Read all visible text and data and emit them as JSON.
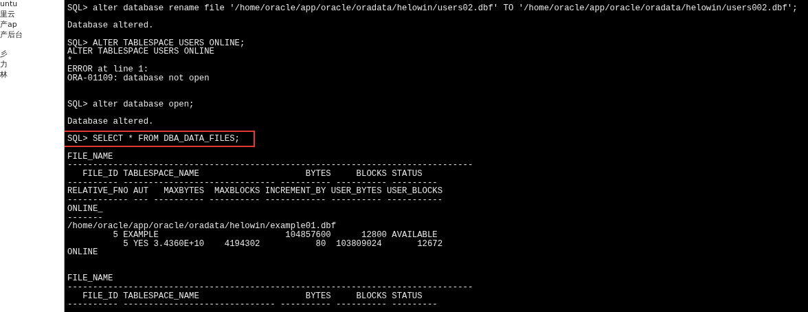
{
  "sidebar": {
    "items": [
      {
        "label": "untu"
      },
      {
        "label": "里云"
      },
      {
        "label": "产ap"
      },
      {
        "label": "产后台"
      },
      {
        "kind": "gap"
      },
      {
        "label": "彡"
      },
      {
        "label": "力"
      },
      {
        "label": "林"
      }
    ]
  },
  "terminal": {
    "lines": [
      {
        "kind": "text",
        "text": "SQL> alter database rename file '/home/oracle/app/oracle/oradata/helowin/users02.dbf' TO '/home/oracle/app/oracle/oradata/helowin/users002.dbf';",
        "highlighted": false
      },
      {
        "kind": "blank"
      },
      {
        "kind": "text",
        "text": "Database altered.",
        "highlighted": false
      },
      {
        "kind": "blank"
      },
      {
        "kind": "text",
        "text": "SQL> ALTER TABLESPACE USERS ONLINE;",
        "highlighted": false
      },
      {
        "kind": "text",
        "text": "ALTER TABLESPACE USERS ONLINE",
        "highlighted": false
      },
      {
        "kind": "text",
        "text": "*",
        "highlighted": false
      },
      {
        "kind": "text",
        "text": "ERROR at line 1:",
        "highlighted": false
      },
      {
        "kind": "text",
        "text": "ORA-01109: database not open",
        "highlighted": false
      },
      {
        "kind": "blank"
      },
      {
        "kind": "blank"
      },
      {
        "kind": "text",
        "text": "SQL> alter database open;",
        "highlighted": false
      },
      {
        "kind": "blank"
      },
      {
        "kind": "text",
        "text": "Database altered.",
        "highlighted": false
      },
      {
        "kind": "blank"
      },
      {
        "kind": "text",
        "text": "SQL> SELECT * FROM DBA_DATA_FILES;",
        "highlighted": true
      },
      {
        "kind": "blank"
      },
      {
        "kind": "text",
        "text": "FILE_NAME",
        "highlighted": false
      },
      {
        "kind": "text",
        "text": "--------------------------------------------------------------------------------",
        "highlighted": false
      },
      {
        "kind": "text",
        "text": "   FILE_ID TABLESPACE_NAME                     BYTES     BLOCKS STATUS",
        "highlighted": false
      },
      {
        "kind": "text",
        "text": "---------- ------------------------------ ---------- ---------- ---------",
        "highlighted": false
      },
      {
        "kind": "text",
        "text": "RELATIVE_FNO AUT   MAXBYTES  MAXBLOCKS INCREMENT_BY USER_BYTES USER_BLOCKS",
        "highlighted": false
      },
      {
        "kind": "text",
        "text": "------------ --- ---------- ---------- ------------ ---------- -----------",
        "highlighted": false
      },
      {
        "kind": "text",
        "text": "ONLINE_",
        "highlighted": false
      },
      {
        "kind": "text",
        "text": "-------",
        "highlighted": false
      },
      {
        "kind": "text",
        "text": "/home/oracle/app/oracle/oradata/helowin/example01.dbf",
        "highlighted": false
      },
      {
        "kind": "text",
        "text": "         5 EXAMPLE                         104857600      12800 AVAILABLE",
        "highlighted": false
      },
      {
        "kind": "text",
        "text": "           5 YES 3.4360E+10    4194302           80  103809024       12672",
        "highlighted": false
      },
      {
        "kind": "text",
        "text": "ONLINE",
        "highlighted": false
      },
      {
        "kind": "blank"
      },
      {
        "kind": "blank"
      },
      {
        "kind": "text",
        "text": "FILE_NAME",
        "highlighted": false
      },
      {
        "kind": "text",
        "text": "--------------------------------------------------------------------------------",
        "highlighted": false
      },
      {
        "kind": "text",
        "text": "   FILE_ID TABLESPACE_NAME                     BYTES     BLOCKS STATUS",
        "highlighted": false
      },
      {
        "kind": "text",
        "text": "---------- ------------------------------ ---------- ---------- ---------",
        "highlighted": false
      }
    ]
  }
}
